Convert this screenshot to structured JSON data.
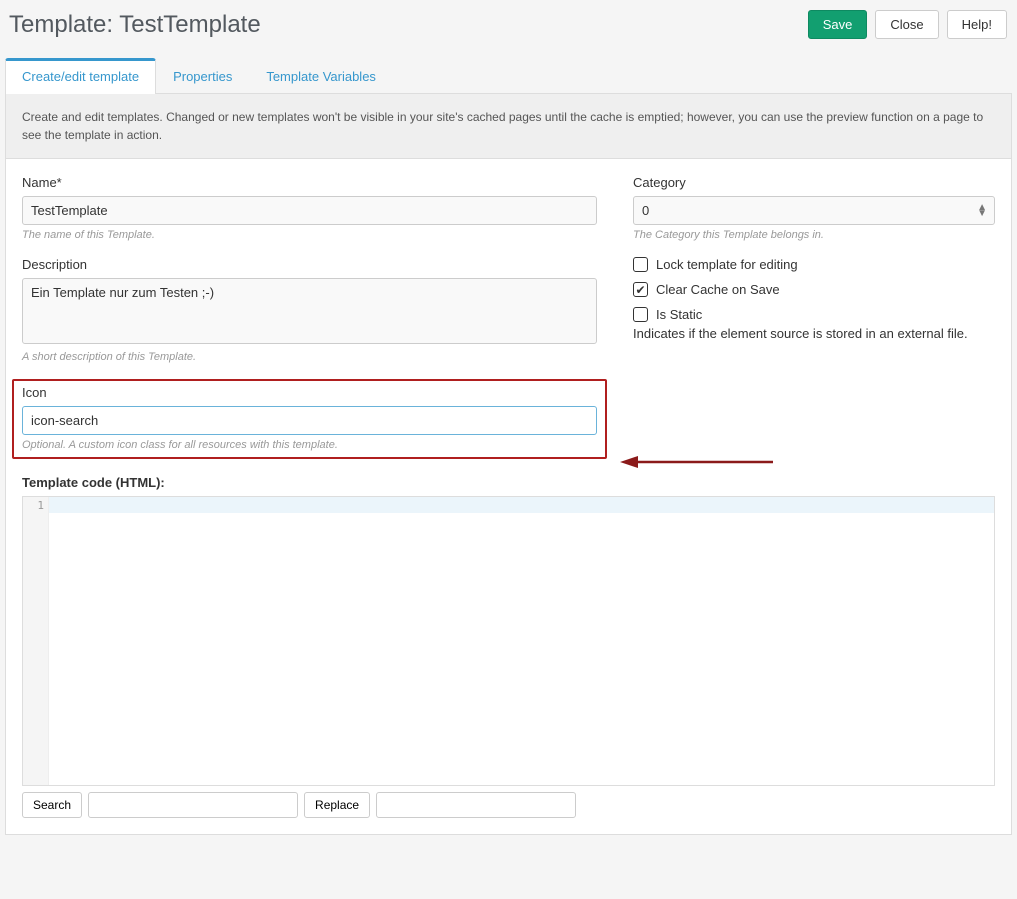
{
  "header": {
    "title": "Template: TestTemplate",
    "buttons": {
      "save": "Save",
      "close": "Close",
      "help": "Help!"
    }
  },
  "tabs": {
    "create_edit": "Create/edit template",
    "properties": "Properties",
    "template_variables": "Template Variables"
  },
  "intro": "Create and edit templates. Changed or new templates won't be visible in your site's cached pages until the cache is emptied; however, you can use the preview function on a page to see the template in action.",
  "fields": {
    "name": {
      "label": "Name*",
      "value": "TestTemplate",
      "help": "The name of this Template."
    },
    "description": {
      "label": "Description",
      "value": "Ein Template nur zum Testen ;-)",
      "help": "A short description of this Template."
    },
    "icon": {
      "label": "Icon",
      "value": "icon-search",
      "help": "Optional. A custom icon class for all resources with this template."
    },
    "category": {
      "label": "Category",
      "selected": "0",
      "help": "The Category this Template belongs in."
    }
  },
  "checkboxes": {
    "lock": {
      "label": "Lock template for editing",
      "checked": false
    },
    "clear_cache": {
      "label": "Clear Cache on Save",
      "checked": true
    },
    "is_static": {
      "label": "Is Static",
      "checked": false,
      "help": "Indicates if the element source is stored in an external file."
    }
  },
  "code": {
    "label": "Template code (HTML):",
    "line_number": "1",
    "search_btn": "Search",
    "replace_btn": "Replace"
  }
}
